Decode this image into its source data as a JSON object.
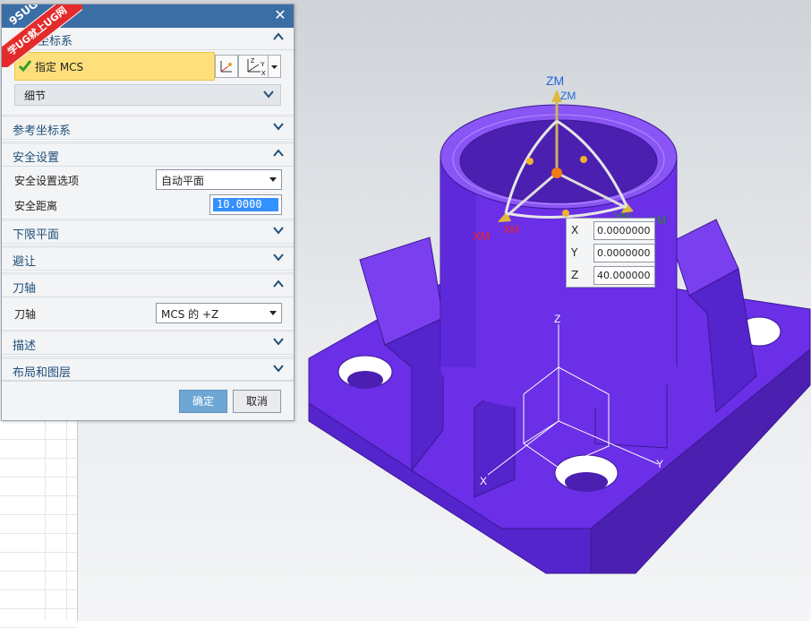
{
  "dialog": {
    "watermark": {
      "top": "9SUG",
      "band": "学UG就上UG网"
    },
    "sections": {
      "mcs": {
        "title": "坐标系",
        "specify_label": "指定 MCS",
        "detail_label": "细节"
      },
      "ref_cs": {
        "title": "参考坐标系"
      },
      "safety": {
        "title": "安全设置",
        "option_label": "安全设置选项",
        "option_value": "自动平面",
        "distance_label": "安全距离",
        "distance_value": "10.0000"
      },
      "lower_plane": {
        "title": "下限平面"
      },
      "avoid": {
        "title": "避让"
      },
      "tool_axis": {
        "title": "刀轴",
        "axis_label": "刀轴",
        "axis_value": "MCS 的 +Z"
      },
      "description": {
        "title": "描述"
      },
      "layout": {
        "title": "布局和图层"
      }
    },
    "buttons": {
      "ok": "确定",
      "cancel": "取消"
    }
  },
  "viewport": {
    "coord_popup": {
      "x_label": "X",
      "x_value": "0.0000000",
      "y_label": "Y",
      "y_value": "0.0000000",
      "z_label": "Z",
      "z_value": "40.000000"
    },
    "manip_labels": {
      "zm": "ZM",
      "zm2": "ZM",
      "xm": "XM",
      "xm2": "XM",
      "ym": "YM",
      "ym2": "YM"
    },
    "wcs_labels": {
      "x": "X",
      "y": "Y",
      "z": "Z"
    },
    "colors": {
      "part": "#6a2fe6",
      "part_dark": "#4b1fb0",
      "part_light": "#8a55f5",
      "accent": "#3a6ea5"
    }
  }
}
